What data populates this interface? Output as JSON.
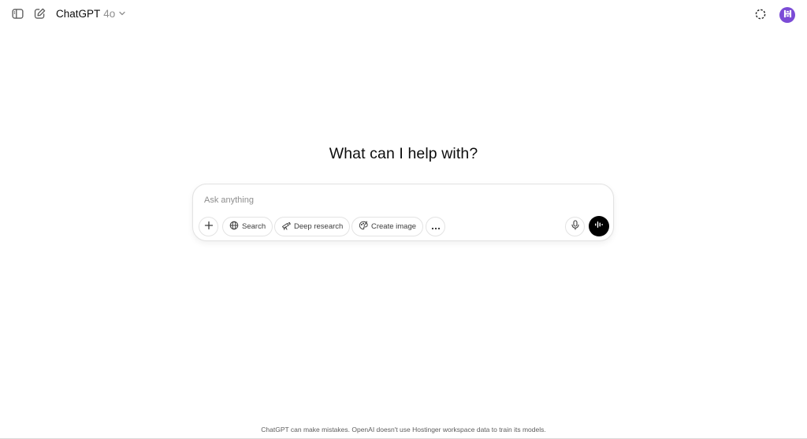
{
  "header": {
    "model_name": "ChatGPT",
    "model_version": "4o"
  },
  "main": {
    "headline": "What can I help with?",
    "composer": {
      "placeholder": "Ask anything",
      "tools": {
        "search_label": "Search",
        "deep_research_label": "Deep research",
        "create_image_label": "Create image"
      }
    }
  },
  "footer": {
    "disclaimer": "ChatGPT can make mistakes. OpenAI doesn't use Hostinger workspace data to train its models."
  },
  "colors": {
    "avatar_bg": "#7b4bd6",
    "voice_button_bg": "#000000"
  }
}
